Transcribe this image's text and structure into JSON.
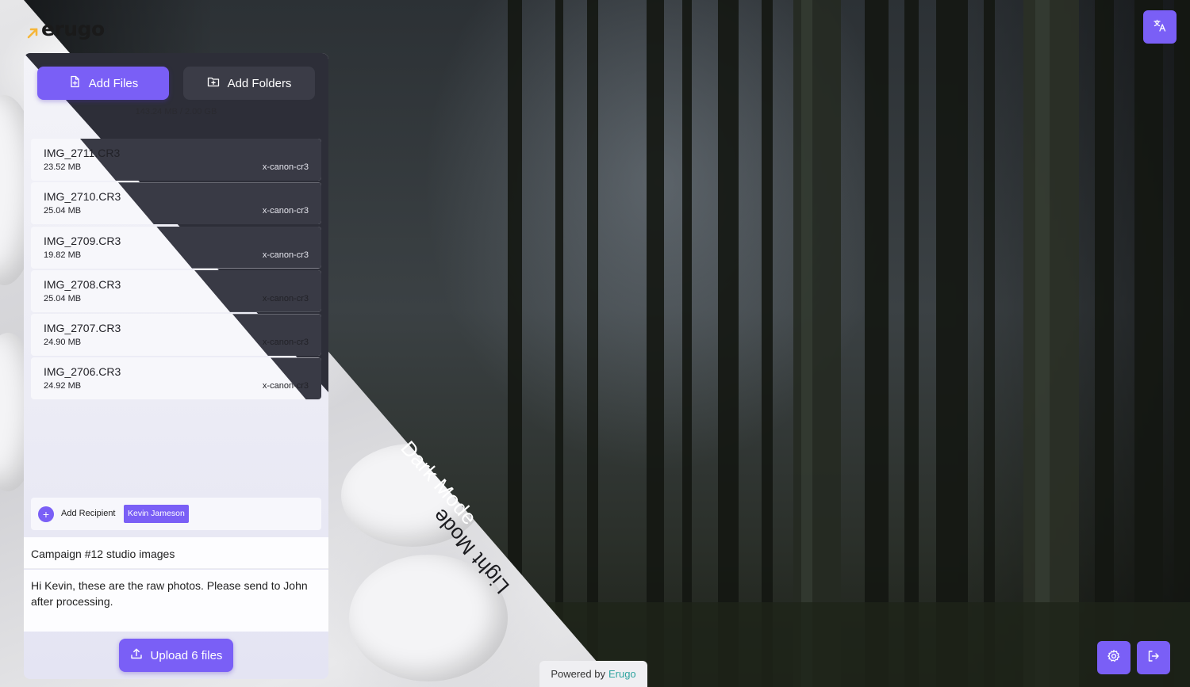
{
  "app": {
    "logo_text": "erugo"
  },
  "colors": {
    "accent": "#7a5ff6",
    "brand_link": "#2fa4a0"
  },
  "toolbar": {
    "add_files_label": "Add Files",
    "add_folders_label": "Add Folders",
    "quota": "143.24 MB / 2.00 GB"
  },
  "files": [
    {
      "name": "IMG_2711.CR3",
      "size": "23.52 MB",
      "type": "x-canon-cr3"
    },
    {
      "name": "IMG_2710.CR3",
      "size": "25.04 MB",
      "type": "x-canon-cr3"
    },
    {
      "name": "IMG_2709.CR3",
      "size": "19.82 MB",
      "type": "x-canon-cr3"
    },
    {
      "name": "IMG_2708.CR3",
      "size": "25.04 MB",
      "type": "x-canon-cr3"
    },
    {
      "name": "IMG_2707.CR3",
      "size": "24.90 MB",
      "type": "x-canon-cr3"
    },
    {
      "name": "IMG_2706.CR3",
      "size": "24.92 MB",
      "type": "x-canon-cr3"
    }
  ],
  "recipients": {
    "add_label": "Add Recipient",
    "items": [
      "Kevin Jameson"
    ]
  },
  "form": {
    "subject": "Campaign #12 studio images",
    "message": "Hi Kevin, these are the raw photos. Please send to John after processing."
  },
  "upload": {
    "label": "Upload 6 files"
  },
  "modes": {
    "dark": "Dark Mode",
    "light": "Light Mode"
  },
  "footer": {
    "powered_prefix": "Powered by",
    "powered_brand": "Erugo"
  },
  "icons": {
    "add_files": "file-plus-icon",
    "add_folders": "folder-plus-icon",
    "upload": "upload-icon",
    "translate": "translate-icon",
    "settings": "gear-icon",
    "logout": "logout-icon",
    "add_recipient": "plus-icon"
  }
}
